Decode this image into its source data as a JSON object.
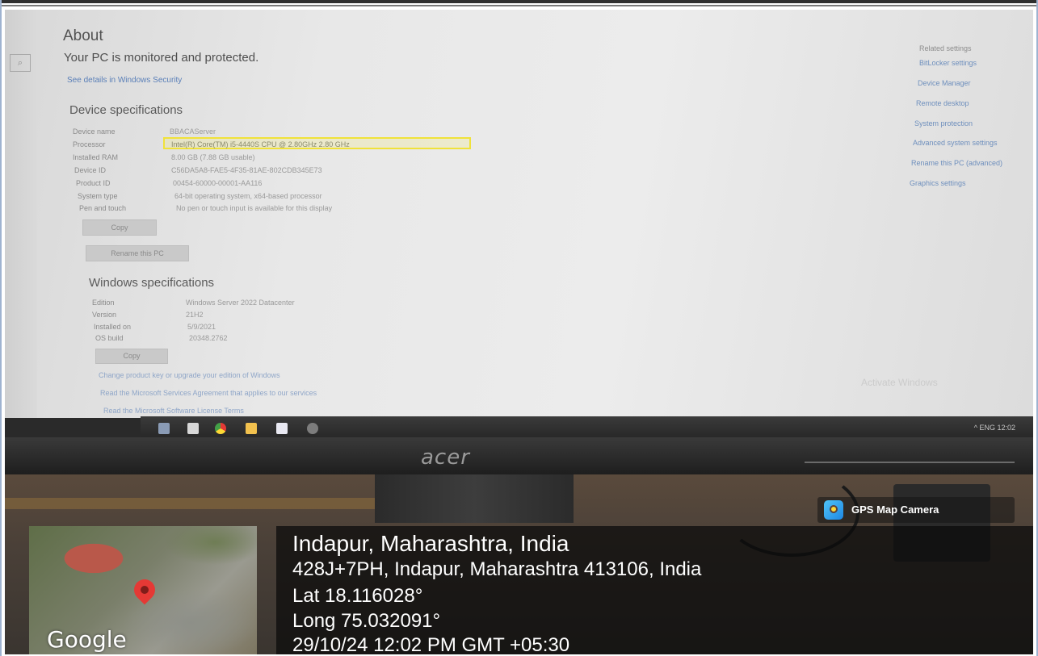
{
  "settings": {
    "title": "About",
    "protection_status": "Your PC is monitored and protected.",
    "security_link": "See details in Windows Security",
    "device_specs": {
      "heading": "Device specifications",
      "rows": [
        {
          "label": "Device name",
          "value": "BBACAServer"
        },
        {
          "label": "Processor",
          "value": "Intel(R) Core(TM) i5-4440S CPU @ 2.80GHz   2.80 GHz"
        },
        {
          "label": "Installed RAM",
          "value": "8.00 GB (7.88 GB usable)"
        },
        {
          "label": "Device ID",
          "value": "C56DA5A8-FAE5-4F35-81AE-802CDB345E73"
        },
        {
          "label": "Product ID",
          "value": "00454-60000-00001-AA116"
        },
        {
          "label": "System type",
          "value": "64-bit operating system, x64-based processor"
        },
        {
          "label": "Pen and touch",
          "value": "No pen or touch input is available for this display"
        }
      ],
      "copy_button": "Copy",
      "rename_button": "Rename this PC"
    },
    "windows_specs": {
      "heading": "Windows specifications",
      "rows": [
        {
          "label": "Edition",
          "value": "Windows Server 2022 Datacenter"
        },
        {
          "label": "Version",
          "value": "21H2"
        },
        {
          "label": "Installed on",
          "value": "5/9/2021"
        },
        {
          "label": "OS build",
          "value": "20348.2762"
        }
      ],
      "copy_button": "Copy"
    },
    "links": [
      "Change product key or upgrade your edition of Windows",
      "Read the Microsoft Services Agreement that applies to our services",
      "Read the Microsoft Software License Terms"
    ],
    "related": {
      "heading": "Related settings",
      "items": [
        "BitLocker settings",
        "Device Manager",
        "Remote desktop",
        "System protection",
        "Advanced system settings",
        "Rename this PC (advanced)",
        "Graphics settings"
      ]
    },
    "watermark": "Activate Windows"
  },
  "taskbar": {
    "tray": "^  ENG  12:02"
  },
  "monitor": {
    "brand": "acer"
  },
  "gps": {
    "app_name": "GPS Map Camera",
    "map_label": "Google",
    "city": "Indapur, Maharashtra, India",
    "address": "428J+7PH, Indapur, Maharashtra 413106, India",
    "latitude": "Lat 18.116028°",
    "longitude": "Long 75.032091°",
    "datetime": "29/10/24 12:02 PM GMT +05:30"
  },
  "colors": {
    "highlight": "#f0e23a",
    "link": "#5a7fb8",
    "pin": "#e53935"
  }
}
